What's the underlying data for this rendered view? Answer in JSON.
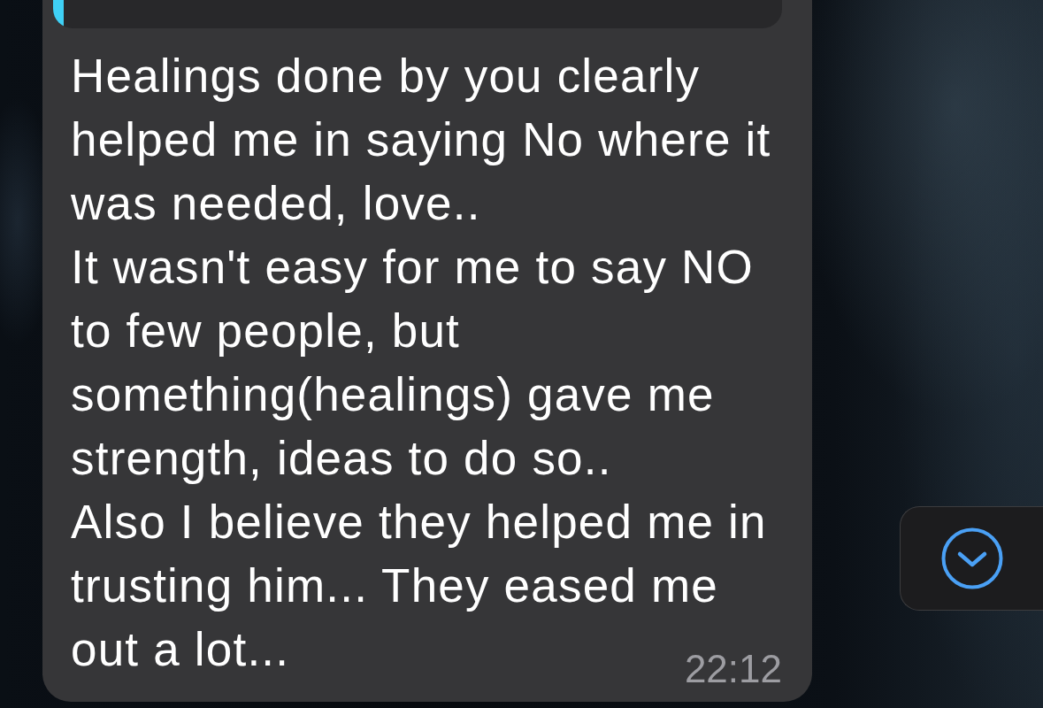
{
  "message": {
    "lines": [
      "Healings done by you clearly",
      "helped me in saying No where it",
      "was needed, love..",
      "It wasn't easy for me to say NO",
      "to few people, but",
      "something(healings) gave me",
      "strength, ideas to do so..",
      "Also I believe they helped me in",
      "trusting him... They eased me",
      "out a lot..."
    ],
    "time": "22:12"
  }
}
